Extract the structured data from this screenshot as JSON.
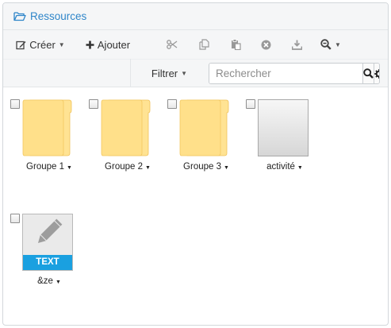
{
  "header": {
    "title": "Ressources",
    "icon": "folder-open-icon"
  },
  "toolbar": {
    "create_label": "Créer",
    "add_label": "Ajouter",
    "filter_label": "Filtrer",
    "icons": [
      "cut-icon",
      "copy-icon",
      "paste-icon",
      "delete-icon",
      "download-icon",
      "zoom-icon"
    ]
  },
  "search": {
    "placeholder": "Rechercher",
    "value": ""
  },
  "items": [
    {
      "label": "Groupe 1",
      "type": "folder"
    },
    {
      "label": "Groupe 2",
      "type": "folder"
    },
    {
      "label": "Groupe 3",
      "type": "folder"
    },
    {
      "label": "activité",
      "type": "document"
    },
    {
      "label": "&ze",
      "type": "text",
      "badge": "TEXT"
    }
  ],
  "colors": {
    "accent": "#2f86c9",
    "folder": "#ffe08a",
    "text_badge": "#1aa0e0"
  }
}
